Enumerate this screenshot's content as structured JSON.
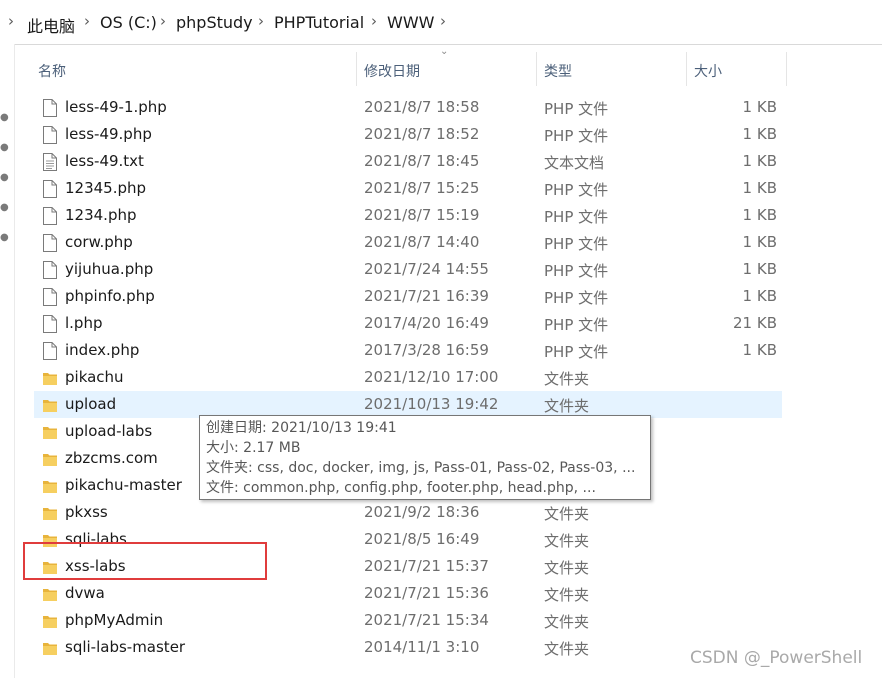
{
  "breadcrumb": {
    "items": [
      "此电脑",
      "OS (C:)",
      "phpStudy",
      "PHPTutorial",
      "WWW"
    ]
  },
  "columns": {
    "name": "名称",
    "modified": "修改日期",
    "type": "类型",
    "size": "大小"
  },
  "files": [
    {
      "name": "less-49-1.php",
      "modified": "2021/8/7 18:58",
      "type": "PHP 文件",
      "size": "1 KB",
      "icon": "file-icon"
    },
    {
      "name": "less-49.php",
      "modified": "2021/8/7 18:52",
      "type": "PHP 文件",
      "size": "1 KB",
      "icon": "file-icon"
    },
    {
      "name": "less-49.txt",
      "modified": "2021/8/7 18:45",
      "type": "文本文档",
      "size": "1 KB",
      "icon": "text-file-icon"
    },
    {
      "name": "12345.php",
      "modified": "2021/8/7 15:25",
      "type": "PHP 文件",
      "size": "1 KB",
      "icon": "file-icon"
    },
    {
      "name": "1234.php",
      "modified": "2021/8/7 15:19",
      "type": "PHP 文件",
      "size": "1 KB",
      "icon": "file-icon"
    },
    {
      "name": "corw.php",
      "modified": "2021/8/7 14:40",
      "type": "PHP 文件",
      "size": "1 KB",
      "icon": "file-icon"
    },
    {
      "name": "yijuhua.php",
      "modified": "2021/7/24 14:55",
      "type": "PHP 文件",
      "size": "1 KB",
      "icon": "file-icon"
    },
    {
      "name": "phpinfo.php",
      "modified": "2021/7/21 16:39",
      "type": "PHP 文件",
      "size": "1 KB",
      "icon": "file-icon"
    },
    {
      "name": "l.php",
      "modified": "2017/4/20 16:49",
      "type": "PHP 文件",
      "size": "21 KB",
      "icon": "file-icon"
    },
    {
      "name": "index.php",
      "modified": "2017/3/28 16:59",
      "type": "PHP 文件",
      "size": "1 KB",
      "icon": "file-icon"
    },
    {
      "name": "pikachu",
      "modified": "2021/12/10 17:00",
      "type": "文件夹",
      "size": "",
      "icon": "folder-icon"
    },
    {
      "name": "upload",
      "modified": "2021/10/13 19:42",
      "type": "文件夹",
      "size": "",
      "icon": "folder-icon"
    },
    {
      "name": "upload-labs",
      "modified": "",
      "type": "",
      "size": "",
      "icon": "folder-icon"
    },
    {
      "name": "zbzcms.com",
      "modified": "",
      "type": "",
      "size": "",
      "icon": "folder-icon"
    },
    {
      "name": "pikachu-master",
      "modified": "",
      "type": "",
      "size": "",
      "icon": "folder-icon"
    },
    {
      "name": "pkxss",
      "modified": "2021/9/2 18:36",
      "type": "文件夹",
      "size": "",
      "icon": "folder-icon"
    },
    {
      "name": "sqli-labs",
      "modified": "2021/8/5 16:49",
      "type": "文件夹",
      "size": "",
      "icon": "folder-icon"
    },
    {
      "name": "xss-labs",
      "modified": "2021/7/21 15:37",
      "type": "文件夹",
      "size": "",
      "icon": "folder-icon"
    },
    {
      "name": "dvwa",
      "modified": "2021/7/21 15:36",
      "type": "文件夹",
      "size": "",
      "icon": "folder-icon"
    },
    {
      "name": "phpMyAdmin",
      "modified": "2021/7/21 15:34",
      "type": "文件夹",
      "size": "",
      "icon": "folder-icon"
    },
    {
      "name": "sqli-labs-master",
      "modified": "2014/11/1 3:10",
      "type": "文件夹",
      "size": "",
      "icon": "folder-icon"
    }
  ],
  "selected_index": 11,
  "tooltip": {
    "lines": [
      "创建日期: 2021/10/13 19:41",
      "大小: 2.17 MB",
      "文件夹: css, doc, docker, img, js, Pass-01, Pass-02, Pass-03, ...",
      "文件: common.php, config.php, footer.php, head.php, ..."
    ]
  },
  "watermark": "CSDN @_PowerShell",
  "colors": {
    "hover_row": "#e5f3ff",
    "highlight_box": "#e03c3c",
    "folder": "#f3c44c"
  }
}
